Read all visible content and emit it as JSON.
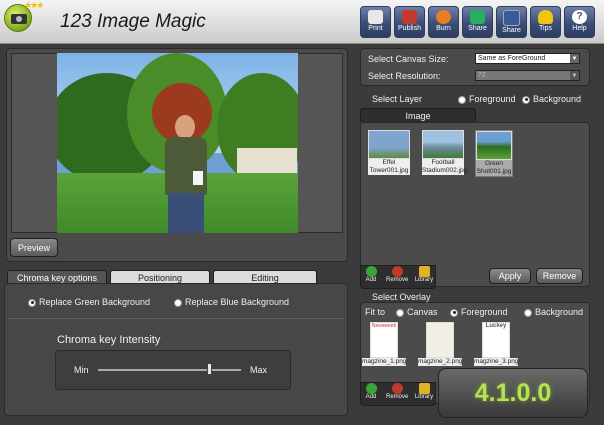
{
  "app": {
    "title": "123 Image Magic",
    "stars": "★★★",
    "version": "4.1.0.0"
  },
  "toolbar": [
    {
      "id": "print",
      "label": "Print",
      "icon": "printer-icon",
      "color": "#e8e8e8"
    },
    {
      "id": "publish",
      "label": "Publish",
      "icon": "publish-icon",
      "color": "#c0392b"
    },
    {
      "id": "burn",
      "label": "Burn",
      "icon": "disc-icon",
      "color": "#e67e22"
    },
    {
      "id": "share1",
      "label": "Share",
      "icon": "share-icon",
      "color": "#27ae60"
    },
    {
      "id": "share2",
      "label": "Share",
      "icon": "facebook-icon",
      "color": "#3b5998"
    },
    {
      "id": "tips",
      "label": "Tips",
      "icon": "lightbulb-icon",
      "color": "#f1c40f"
    },
    {
      "id": "help",
      "label": "Help",
      "icon": "help-icon",
      "color": "#5b6e96"
    }
  ],
  "preview": {
    "button": "Preview"
  },
  "tabs": [
    {
      "label": "Chroma key options",
      "active": true
    },
    {
      "label": "Positioning",
      "active": false
    },
    {
      "label": "Editing",
      "active": false
    }
  ],
  "chroma": {
    "replace_green": "Replace Green Background",
    "replace_blue": "Replace Blue Background",
    "intensity_title": "Chroma key Intensity",
    "min": "Min",
    "max": "Max",
    "intensity": 0.78
  },
  "canvas": {
    "size_label": "Select  Canvas Size:",
    "size_value": "Same as ForeGround",
    "resolution_label": "Select  Resolution:",
    "resolution_value": "72"
  },
  "layer": {
    "label": "Select  Layer",
    "foreground": "Foreground",
    "background": "Background",
    "tab": "Image",
    "thumbs": [
      {
        "caption": "Effel Tower001.jpg",
        "color": "#7fa5cf"
      },
      {
        "caption": "Football Stadium002.jpg",
        "color": "#6f8fa0"
      },
      {
        "caption": "Green Shot001.jpg",
        "color": "#4f8a3a"
      }
    ],
    "add": "Add",
    "remove": "Remove",
    "library": "Library",
    "apply_button": "Apply",
    "remove_button": "Remove"
  },
  "overlay": {
    "title": "Select Overlay",
    "fit_to": "Fit to",
    "canvas": "Canvas",
    "foreground": "Foreground",
    "background": "Background",
    "thumbs": [
      {
        "caption": "magzine_1.png"
      },
      {
        "caption": "magzine_2.png"
      },
      {
        "caption": "magzine_3.png"
      }
    ],
    "thumb1_text": "Newsweek",
    "thumb3_text": "Luckey",
    "add": "Add",
    "remove": "Remove",
    "library": "Library"
  }
}
